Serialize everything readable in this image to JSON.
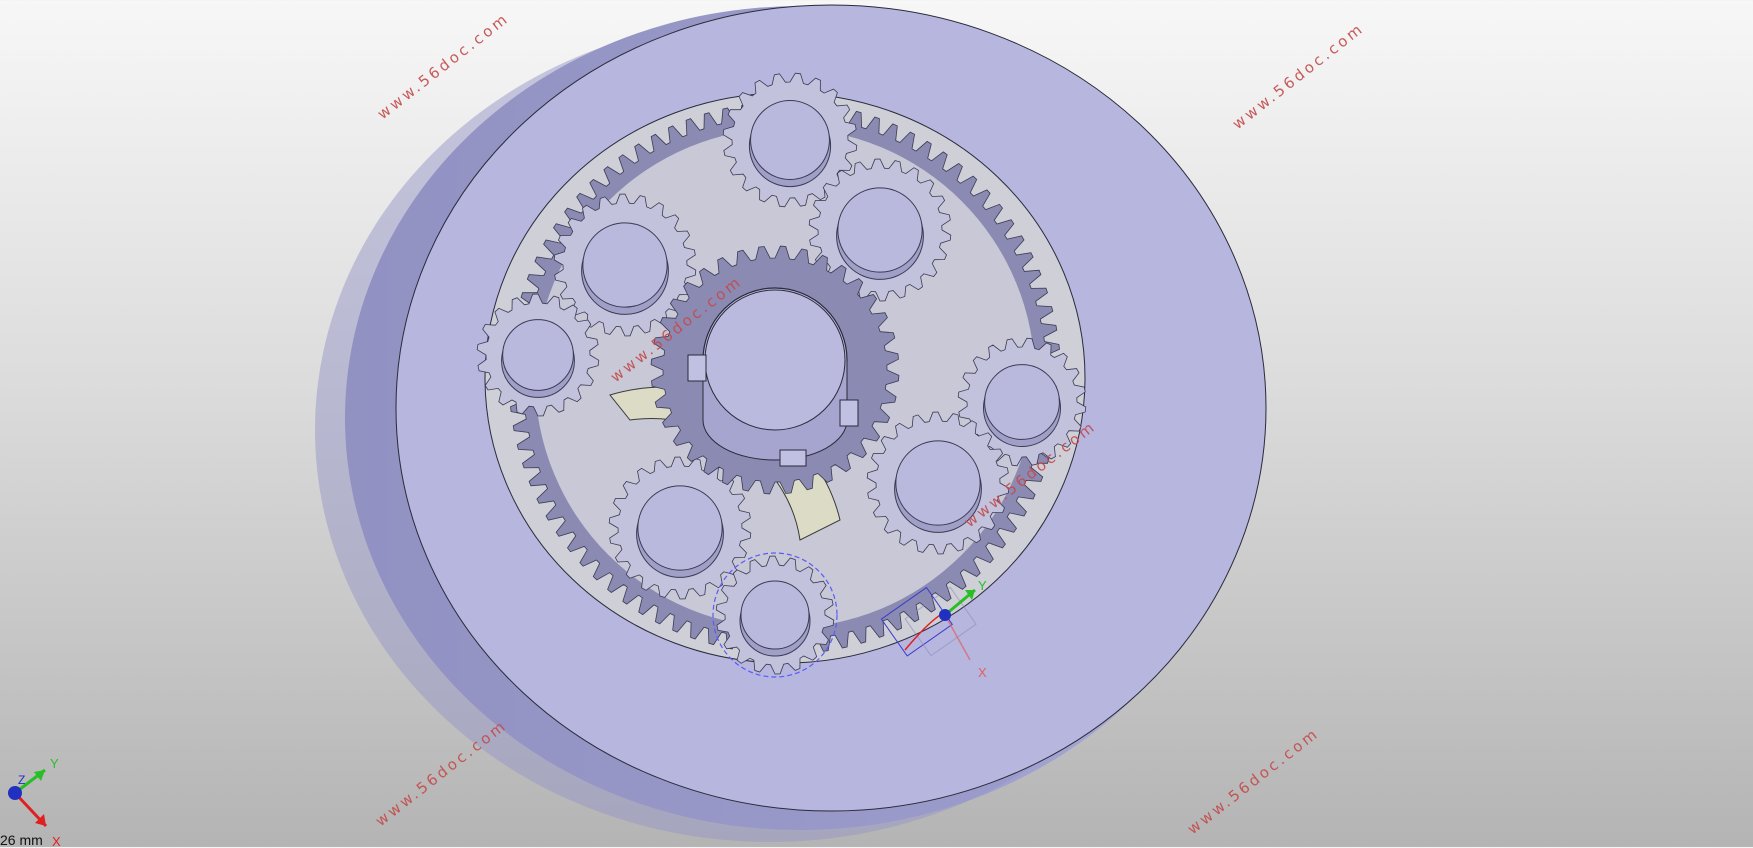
{
  "viewport": {
    "background_top": "#f7f7f7",
    "background_bottom": "#b4b4b4"
  },
  "model": {
    "body_color": "#b6b6df",
    "body_side_color": "#9797c6",
    "gear_color": "#8a8ab2",
    "gear_edge_color": "#3a3a52",
    "selection_color": "#5a5aff"
  },
  "watermarks": [
    "www.56doc.com",
    "www.56doc.com",
    "www.56doc.com",
    "www.56doc.com",
    "www.56doc.com",
    "www.56doc.com"
  ],
  "axis_triad": {
    "x_label": "X",
    "y_label": "Y",
    "z_label": "Z",
    "scale_text": "26 mm"
  },
  "local_csys": {
    "x_label": "X",
    "y_label": "Y"
  }
}
